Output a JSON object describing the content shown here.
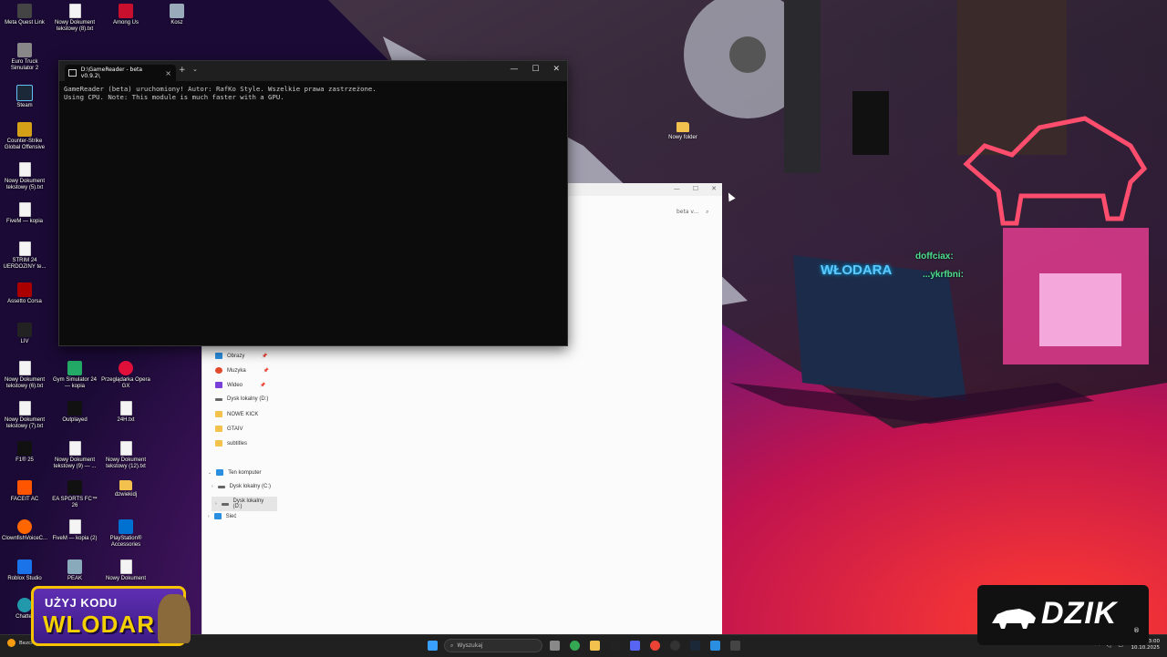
{
  "desktop_icons": [
    {
      "label": "Meta Quest Link",
      "color": "#444"
    },
    {
      "label": "Nowy Dokument tekstowy (8).txt",
      "type": "doc"
    },
    {
      "label": "Among Us",
      "color": "#c8102e"
    },
    {
      "label": "Kosz",
      "color": "#9ab"
    },
    {
      "label": "Euro Truck Simulator 2",
      "color": "#888"
    },
    {
      "label": "Steam",
      "color": "#1b2838"
    },
    {
      "label": "Counter-Strike Global Offensive",
      "color": "#d4a017"
    },
    {
      "label": "Nowy Dokument tekstowy (5).txt",
      "type": "doc"
    },
    {
      "label": "FiveM — kopia",
      "type": "doc"
    },
    {
      "label": "STRIM 24 UERDOZINY te...",
      "type": "doc"
    },
    {
      "label": "Assetto Corsa",
      "color": "#a00"
    },
    {
      "label": "LIV",
      "color": "#222"
    },
    {
      "label": "Nowy Dokument tekstowy (6).txt",
      "type": "doc"
    },
    {
      "label": "Gym Simulator 24 — kopia",
      "color": "#2a6"
    },
    {
      "label": "Przeglądarka Opera GX",
      "color": "#e0103b"
    },
    {
      "label": "Nowy Dokument tekstowy (7).txt",
      "type": "doc"
    },
    {
      "label": "Outplayed",
      "color": "#111"
    },
    {
      "label": "24H.txt",
      "type": "doc"
    },
    {
      "label": "F1® 25",
      "color": "#111"
    },
    {
      "label": "Nowy Dokument tekstowy (9) — ...",
      "type": "doc"
    },
    {
      "label": "Nowy Dokument tekstowy (12).txt",
      "type": "doc"
    },
    {
      "label": "FACEIT AC",
      "color": "#ff5500"
    },
    {
      "label": "EA SPORTS FC™ 26",
      "color": "#111"
    },
    {
      "label": "dzwiekidj",
      "type": "folder"
    },
    {
      "label": "ClownfishVoiceC...",
      "color": "#f60"
    },
    {
      "label": "FiveM — kopia (2)",
      "type": "doc"
    },
    {
      "label": "PlayStation® Accessories",
      "color": "#0070d1"
    },
    {
      "label": "Roblox Studio",
      "color": "#1a73e8"
    },
    {
      "label": "PEAK",
      "color": "#8ab"
    },
    {
      "label": "Nowy Dokument",
      "type": "doc"
    },
    {
      "label": "Chatter",
      "color": "#29a"
    }
  ],
  "desktop_folder": {
    "label": "Nowy folder"
  },
  "terminal": {
    "tab_title": "D:\\GameReader - beta v0.9.2\\",
    "close_glyph": "×",
    "plus_glyph": "+",
    "dropdown_glyph": "⌄",
    "min_glyph": "—",
    "max_glyph": "☐",
    "win_close_glyph": "✕",
    "lines": [
      "GameReader (beta) uruchomiony! Autor: RafKo Style. Wszelkie prawa zastrzeżone.",
      "Using CPU. Note: This module is much faster with a GPU."
    ]
  },
  "explorer": {
    "search_placeholder": "beta v...",
    "min_glyph": "—",
    "max_glyph": "☐",
    "close_glyph": "✕",
    "nav": [
      {
        "label": "Obrazy",
        "color": "#2a8fe0",
        "pinned": true
      },
      {
        "label": "Muzyka",
        "color": "#e04a2a",
        "pinned": true
      },
      {
        "label": "Wideo",
        "color": "#7a3fd6",
        "pinned": true
      },
      {
        "label": "Dysk lokalny (D:)",
        "color": "#666",
        "pinned": false
      },
      {
        "label": "NOWE KICK",
        "color": "#f2c14e",
        "pinned": false
      },
      {
        "label": "GTAIV",
        "color": "#f2c14e",
        "pinned": false
      },
      {
        "label": "subtitles",
        "color": "#f2c14e",
        "pinned": false
      },
      {
        "label": "Ten komputer",
        "color": "#2a8fe0",
        "pinned": false
      },
      {
        "label": "Dysk lokalny (C:)",
        "color": "#666",
        "pinned": false
      },
      {
        "label": "Dysk lokalny (D:)",
        "color": "#666",
        "pinned": false,
        "selected": true
      },
      {
        "label": "Sieć",
        "color": "#2a8fe0",
        "pinned": false
      }
    ]
  },
  "taskbar": {
    "search_placeholder": "Wyszukaj",
    "time": "13:00",
    "date": "10.10.2025",
    "left_item": "Bezchmurnie"
  },
  "overlay": {
    "promo_line1": "UŻYJ KODU",
    "promo_line2": "WLODAR",
    "sponsor": "DZIK",
    "chat_user1": "doffciax:",
    "chat_user2": "...ykrfbni:",
    "poster": "WŁODARA"
  }
}
